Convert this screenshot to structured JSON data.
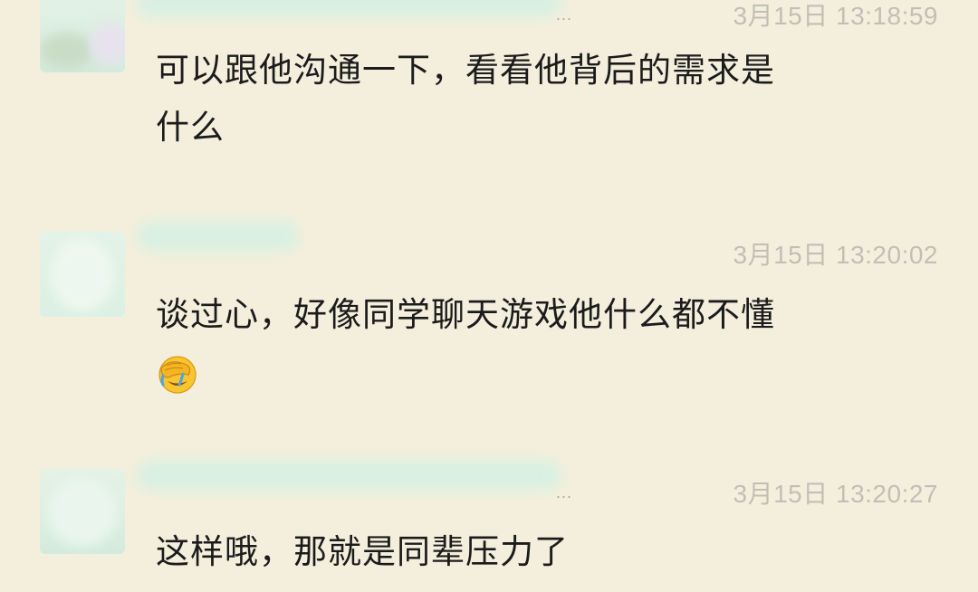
{
  "messages": [
    {
      "timestamp": "3月15日 13:18:59",
      "name_suffix": "...",
      "text_line1": "可以跟他沟通一下，看看他背后的需求是",
      "text_line2": "什么"
    },
    {
      "timestamp": "3月15日 13:20:02",
      "text_line1": "谈过心，好像同学聊天游戏他什么都不懂",
      "emoji": "face-with-hand-over-eyes-icon"
    },
    {
      "timestamp": "3月15日 13:20:27",
      "name_suffix": "...",
      "text_line1": "这样哦，那就是同辈压力了"
    }
  ],
  "colors": {
    "background": "#f4efdd",
    "text": "#1b1b1b",
    "timestamp": "#c1bfb5",
    "blur_tint": "#d9f0e1"
  }
}
